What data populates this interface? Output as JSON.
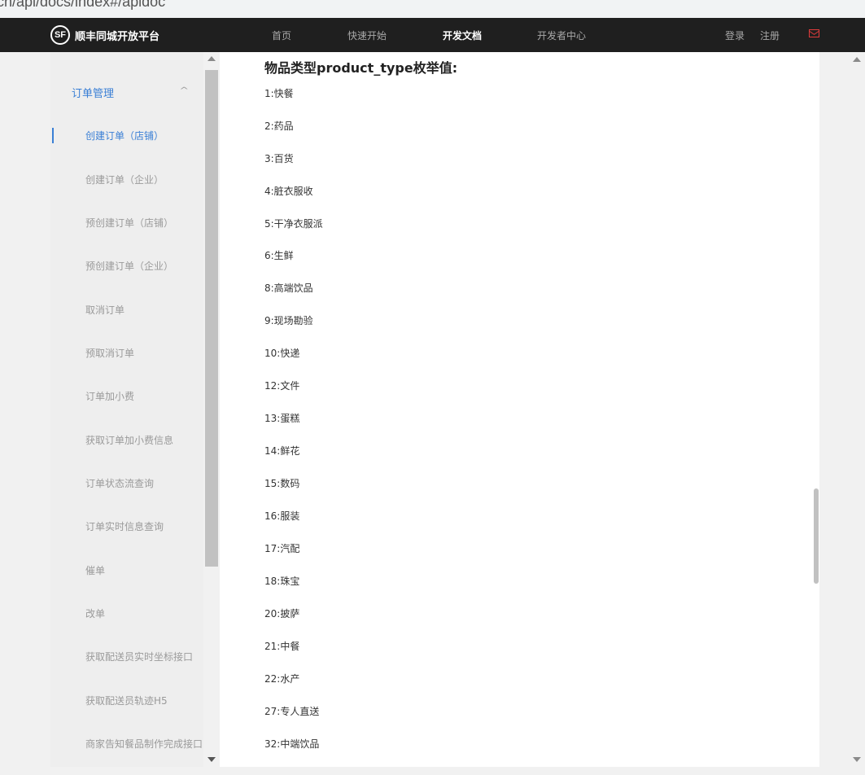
{
  "url": "ch/api/docs/index#/apidoc",
  "navbar": {
    "logo_mark": "SF",
    "brand": "顺丰同城开放平台",
    "items": [
      {
        "label": "首页",
        "active": false
      },
      {
        "label": "快速开始",
        "active": false
      },
      {
        "label": "开发文档",
        "active": true
      },
      {
        "label": "开发者中心",
        "active": false
      }
    ],
    "login": "登录",
    "register": "注册",
    "mail_icon": "mail-icon",
    "accent_color": "#e03b3b"
  },
  "sidebar": {
    "group": "订单管理",
    "items": [
      {
        "label": "创建订单（店铺）",
        "active": true
      },
      {
        "label": "创建订单（企业）",
        "active": false
      },
      {
        "label": "预创建订单（店铺）",
        "active": false
      },
      {
        "label": "预创建订单（企业）",
        "active": false
      },
      {
        "label": "取消订单",
        "active": false
      },
      {
        "label": "预取消订单",
        "active": false
      },
      {
        "label": "订单加小费",
        "active": false
      },
      {
        "label": "获取订单加小费信息",
        "active": false
      },
      {
        "label": "订单状态流查询",
        "active": false
      },
      {
        "label": "订单实时信息查询",
        "active": false
      },
      {
        "label": "催单",
        "active": false
      },
      {
        "label": "改单",
        "active": false
      },
      {
        "label": "获取配送员实时坐标接口",
        "active": false
      },
      {
        "label": "获取配送员轨迹H5",
        "active": false
      },
      {
        "label": "商家告知餐品制作完成接口",
        "active": false
      }
    ],
    "active_color": "#3a7fd5"
  },
  "content": {
    "title": "物品类型product_type枚举值:",
    "items": [
      "1:快餐",
      "2:药品",
      "3:百货",
      "4:脏衣服收",
      "5:干净衣服派",
      "6:生鲜",
      "8:高端饮品",
      "9:现场勘验",
      "10:快递",
      "12:文件",
      "13:蛋糕",
      "14:鲜花",
      "15:数码",
      "16:服装",
      "17:汽配",
      "18:珠宝",
      "20:披萨",
      "21:中餐",
      "22:水产",
      "27:专人直送",
      "32:中端饮品"
    ]
  }
}
